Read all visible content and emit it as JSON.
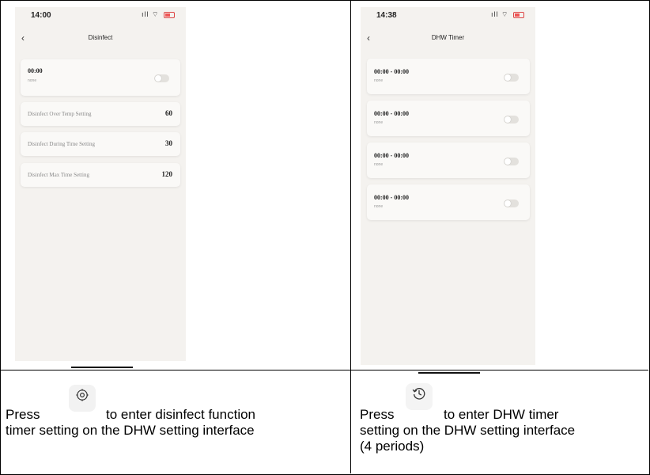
{
  "left_phone": {
    "status_time": "14:00",
    "nav_title": "Disinfect",
    "schedule": {
      "time": "00:00",
      "sub": "none",
      "enabled": false
    },
    "settings": [
      {
        "label": "Disinfect Over Temp Setting",
        "value": "60"
      },
      {
        "label": "Disinfect During Time Setting",
        "value": "30"
      },
      {
        "label": "Disinfect Max Time Setting",
        "value": "120"
      }
    ]
  },
  "right_phone": {
    "status_time": "14:38",
    "nav_title": "DHW Timer",
    "periods": [
      {
        "time": "00:00 - 00:00",
        "sub": "none",
        "enabled": false
      },
      {
        "time": "00:00 - 00:00",
        "sub": "none",
        "enabled": false
      },
      {
        "time": "00:00 - 00:00",
        "sub": "none",
        "enabled": false
      },
      {
        "time": "00:00 - 00:00",
        "sub": "none",
        "enabled": false
      }
    ]
  },
  "captions": {
    "left_prefix": "Press",
    "left_suffix_1": "to enter disinfect function",
    "left_line_2": "timer setting on the DHW setting interface",
    "left_icon": "gear-icon",
    "right_prefix": "Press",
    "right_suffix_1": "to enter DHW timer",
    "right_line_2": "setting on the DHW setting interface",
    "right_line_3": "(4 periods)",
    "right_icon": "timer-icon"
  }
}
